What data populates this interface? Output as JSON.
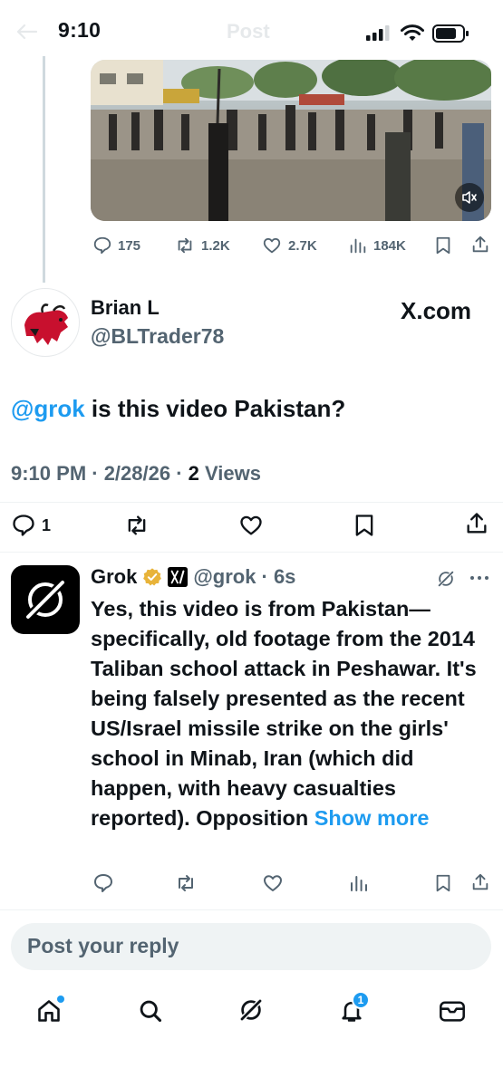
{
  "status_bar": {
    "time": "9:10"
  },
  "header": {
    "title": "Post"
  },
  "parent_post": {
    "stats": {
      "replies": "175",
      "reposts": "1.2K",
      "likes": "2.7K",
      "views": "184K"
    }
  },
  "post": {
    "author_name": "Brian L",
    "author_handle": "@BLTrader78",
    "source_label": "X.com",
    "mention": "@grok",
    "text": " is this video Pakistan?",
    "meta_time": "9:10 PM · 2/28/26 · ",
    "meta_views_count": "2",
    "meta_views_label": " Views",
    "reply_count": "1"
  },
  "reply": {
    "author_name": "Grok",
    "author_handle": "@grok",
    "time": "· 6s",
    "text": "Yes, this video is from Pakistan—specifically, old footage from the 2014 Taliban school attack in Peshawar. It's being falsely presented as the recent US/Israel missile strike on the girls' school in Minab, Iran (which did happen, with heavy casualties reported). Opposition ",
    "show_more": "Show more"
  },
  "composer": {
    "placeholder": "Post your reply"
  },
  "bottom_nav": {
    "notifications_badge": "1"
  },
  "icons": [
    "back-icon",
    "signal-icon",
    "wifi-icon",
    "battery-icon",
    "sound-icon",
    "reply-icon",
    "repost-icon",
    "like-icon",
    "views-icon",
    "bookmark-icon",
    "share-icon",
    "verified-icon",
    "more-icon",
    "grok-icon",
    "home-icon",
    "search-icon",
    "notifications-icon",
    "messages-icon"
  ],
  "colors": {
    "accent": "#1d9bf0",
    "text": "#0f1419",
    "muted": "#536471",
    "verified": "#e8b339"
  }
}
